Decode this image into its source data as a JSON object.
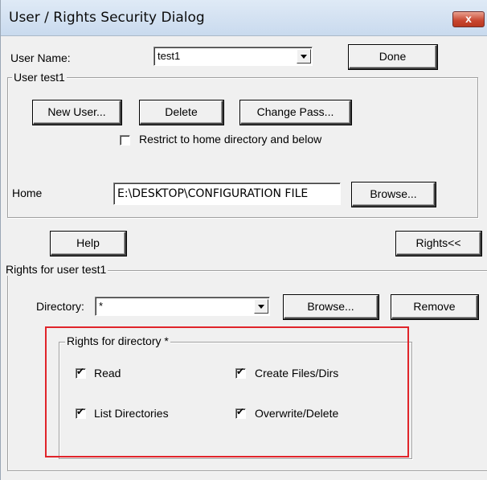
{
  "window": {
    "title": "User / Rights Security Dialog",
    "close_glyph": "x"
  },
  "user": {
    "label": "User Name:",
    "selected": "test1",
    "done_label": "Done"
  },
  "user_group": {
    "legend": "User test1",
    "new_user_label": "New User...",
    "delete_label": "Delete",
    "change_pass_label": "Change Pass...",
    "restrict_label": "Restrict to home directory and below",
    "restrict_checked": false,
    "home_label": "Home",
    "home_value": "E:\\DESKTOP\\CONFIGURATION FILE",
    "browse_label": "Browse..."
  },
  "actions": {
    "help_label": "Help",
    "rights_label": "Rights<<"
  },
  "rights_group": {
    "legend": "Rights for user test1",
    "directory_label": "Directory:",
    "directory_value": "*",
    "browse_label": "Browse...",
    "remove_label": "Remove"
  },
  "dir_rights": {
    "legend": "Rights for directory *",
    "read_label": "Read",
    "list_label": "List Directories",
    "create_label": "Create Files/Dirs",
    "overwrite_label": "Overwrite/Delete",
    "read_checked": true,
    "list_checked": true,
    "create_checked": true,
    "overwrite_checked": true
  },
  "colors": {
    "highlight": "#e0242a",
    "dialog_bg": "#f0f0f0",
    "close_button": "#c8452f"
  }
}
